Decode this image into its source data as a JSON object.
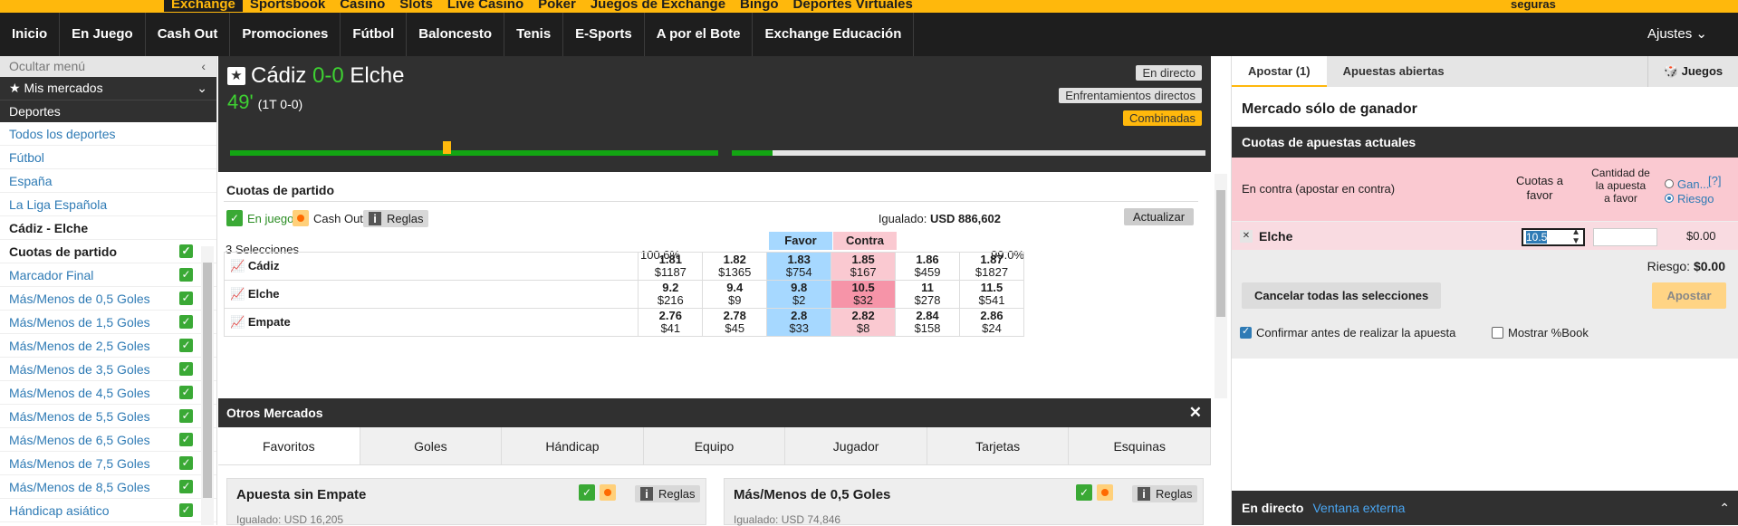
{
  "topbar": {
    "tabs": [
      "Exchange",
      "Sportsbook",
      "Casino",
      "Slots",
      "Live Casino",
      "Poker",
      "Juegos de Exchange",
      "Bingo",
      "Deportes Virtuales"
    ],
    "right": "seguras"
  },
  "nav": {
    "items": [
      "Inicio",
      "En Juego",
      "Cash Out",
      "Promociones",
      "Fútbol",
      "Baloncesto",
      "Tenis",
      "E-Sports",
      "A por el Bote",
      "Exchange Educación"
    ],
    "ajustes": "Ajustes"
  },
  "left": {
    "hide_menu": "Ocultar menú",
    "my_markets": "Mis mercados",
    "sports": "Deportes",
    "links": [
      "Todos los deportes",
      "Fútbol",
      "España",
      "La Liga Española"
    ],
    "match": "Cádiz - Elche",
    "markets": [
      "Cuotas de partido",
      "Marcador Final",
      "Más/Menos de 0,5 Goles",
      "Más/Menos de 1,5 Goles",
      "Más/Menos de 2,5 Goles",
      "Más/Menos de 3,5 Goles",
      "Más/Menos de 4,5 Goles",
      "Más/Menos de 5,5 Goles",
      "Más/Menos de 6,5 Goles",
      "Más/Menos de 7,5 Goles",
      "Más/Menos de 8,5 Goles",
      "Hándicap asiático"
    ]
  },
  "match": {
    "home": "Cádiz",
    "score": "0-0",
    "away": "Elche",
    "minute": "49'",
    "half": "(1T 0-0)",
    "btn_live": "En directo",
    "btn_h2h": "Enfrentamientos directos",
    "btn_combo": "Combinadas"
  },
  "market": {
    "title": "Cuotas de partido",
    "in_play": "En juego",
    "cash_out": "Cash Out",
    "rules": "Reglas",
    "matched_label": "Igualado:",
    "matched_value": "USD 886,602",
    "refresh": "Actualizar",
    "selections": "3 Selecciones",
    "pct_back": "100.6%",
    "pct_lay": "99.0%",
    "favor": "Favor",
    "contra": "Contra",
    "runners": [
      {
        "name": "Cádiz",
        "odds": [
          [
            "1.81",
            "$1187"
          ],
          [
            "1.82",
            "$1365"
          ],
          [
            "1.83",
            "$754"
          ],
          [
            "1.85",
            "$167"
          ],
          [
            "1.86",
            "$459"
          ],
          [
            "1.87",
            "$1827"
          ]
        ]
      },
      {
        "name": "Elche",
        "odds": [
          [
            "9.2",
            "$216"
          ],
          [
            "9.4",
            "$9"
          ],
          [
            "9.8",
            "$2"
          ],
          [
            "10.5",
            "$32"
          ],
          [
            "11",
            "$278"
          ],
          [
            "11.5",
            "$541"
          ]
        ]
      },
      {
        "name": "Empate",
        "odds": [
          [
            "2.76",
            "$41"
          ],
          [
            "2.78",
            "$45"
          ],
          [
            "2.8",
            "$33"
          ],
          [
            "2.82",
            "$8"
          ],
          [
            "2.84",
            "$158"
          ],
          [
            "2.86",
            "$24"
          ]
        ]
      }
    ]
  },
  "otros": {
    "title": "Otros Mercados",
    "tabs": [
      "Favoritos",
      "Goles",
      "Hándicap",
      "Equipo",
      "Jugador",
      "Tarjetas",
      "Esquinas"
    ],
    "cards": [
      {
        "title": "Apuesta sin Empate",
        "rules": "Reglas",
        "sub": "Igualado: USD 16,205"
      },
      {
        "title": "Más/Menos de 0,5 Goles",
        "rules": "Reglas",
        "sub": "Igualado: USD 74,846"
      }
    ]
  },
  "betslip": {
    "tab_bet": "Apostar (1)",
    "tab_open": "Apuestas abiertas",
    "games": "Juegos",
    "title": "Mercado sólo de ganador",
    "current": "Cuotas de apuestas actuales",
    "lay_label": "En contra (apostar en contra)",
    "col_odds": "Cuotas a favor",
    "col_stake": "Cantidad de la apuesta a favor",
    "opt_gan": "Gan...",
    "opt_riesgo": "Riesgo",
    "help": "[?]",
    "runner": "Elche",
    "odds_value": "10.5",
    "amount": "$0.00",
    "risk_label": "Riesgo:",
    "risk_value": "$0.00",
    "cancel_all": "Cancelar todas las selecciones",
    "place": "Apostar",
    "confirm": "Confirmar antes de realizar la apuesta",
    "show_book": "Mostrar %Book",
    "live": "En directo",
    "external": "Ventana externa"
  }
}
